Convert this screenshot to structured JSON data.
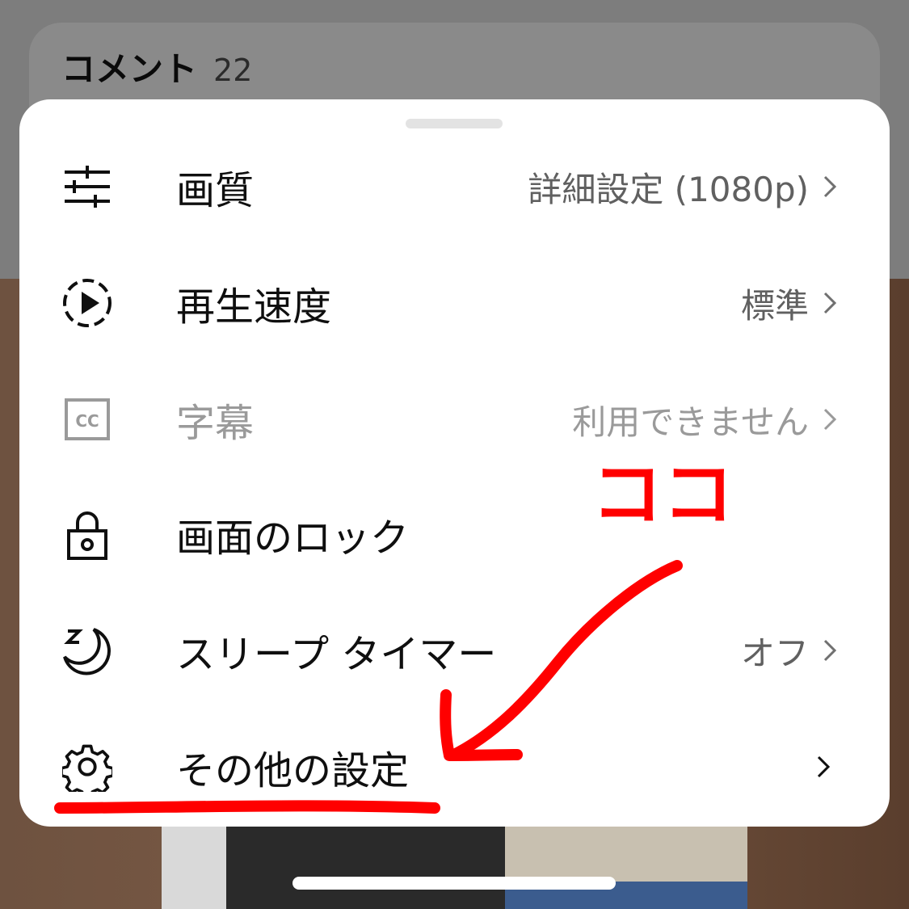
{
  "comments": {
    "title": "コメント",
    "count": "22"
  },
  "sheet": {
    "items": [
      {
        "label": "画質",
        "value": "詳細設定 (1080p)",
        "icon": "sliders-icon",
        "enabled": true
      },
      {
        "label": "再生速度",
        "value": "標準",
        "icon": "playback-speed-icon",
        "enabled": true
      },
      {
        "label": "字幕",
        "value": "利用できません",
        "icon": "captions-icon",
        "enabled": false
      },
      {
        "label": "画面のロック",
        "value": "",
        "icon": "lock-icon",
        "enabled": true
      },
      {
        "label": "スリープ タイマー",
        "value": "オフ",
        "icon": "sleep-timer-icon",
        "enabled": true
      },
      {
        "label": "その他の設定",
        "value": "",
        "icon": "gear-icon",
        "enabled": true
      }
    ]
  },
  "annotation": {
    "text": "ココ",
    "color": "#ff0000"
  },
  "colors": {
    "sheet_bg": "#ffffff",
    "text": "#0f0f0f",
    "secondary": "#606060",
    "disabled": "#9a9a9a"
  }
}
